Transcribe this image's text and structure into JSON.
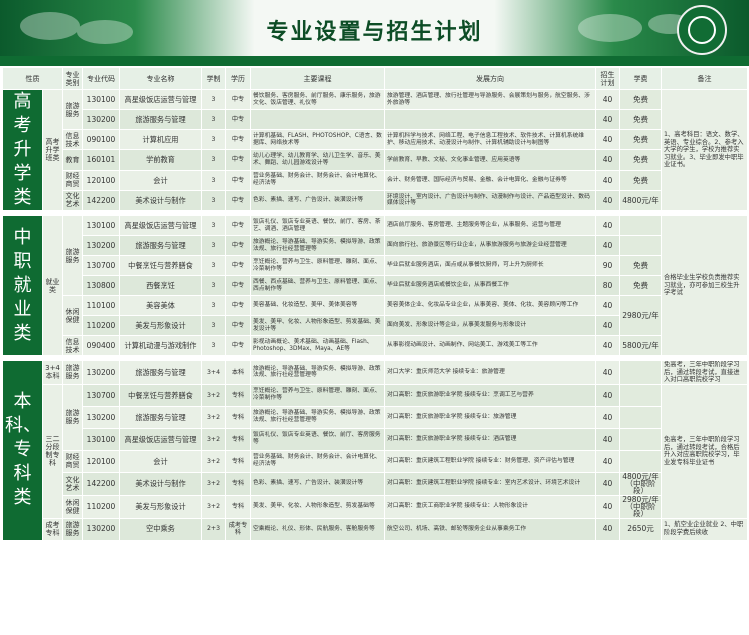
{
  "page": {
    "title": "专业设置与招生计划"
  },
  "headers": [
    "性质",
    "专业类别",
    "专业代码",
    "专业名称",
    "学制",
    "学历",
    "主要课程",
    "发展方向",
    "招生计划",
    "学费",
    "备注"
  ],
  "sections": {
    "gaokao": {
      "band": "高考升学类",
      "category": "高考升学班类",
      "rows": [
        {
          "group": "旅游服务",
          "code": "130100",
          "name": "高星级饭店运营与管理",
          "years": "3",
          "level": "中专",
          "courses": "餐饮服务、客房服务、前厅服务、康乐服务，旅游文化、饭店管理、礼仪等",
          "direction": "旅游管理、酒店管理、旅行社管理与导游服务、会展策划与服务，航空服务、涉外旅游等",
          "plan": "40",
          "fee": "免费"
        },
        {
          "group": "旅游服务",
          "code": "130200",
          "name": "旅游服务与管理",
          "years": "3",
          "level": "中专",
          "courses": "",
          "direction": "",
          "plan": "40",
          "fee": "免费"
        },
        {
          "group": "信息技术",
          "code": "090100",
          "name": "计算机应用",
          "years": "3",
          "level": "中专",
          "courses": "计算机基础、FLASH、PHOTOSHOP、C语言、数据库、网络技术等",
          "direction": "计算机科学与技术、网络工程、电子信息工程技术、软件技术、计算机系统维护、移动应用技术、动漫设计与制作、计算机辅助设计与制图等",
          "plan": "40",
          "fee": "免费"
        },
        {
          "group": "教育",
          "code": "160101",
          "name": "学前教育",
          "years": "3",
          "level": "中专",
          "courses": "幼儿心理学、幼儿教育学、幼儿卫生学、音乐、美术、舞蹈、幼儿园游戏设计等",
          "direction": "学前教育、早教、文秘、文化事业管理、应用英语等",
          "plan": "40",
          "fee": "免费"
        },
        {
          "group": "财经商贸",
          "code": "120100",
          "name": "会计",
          "years": "3",
          "level": "中专",
          "courses": "营业务基础、财务会计、财务会计、会计电算化、经济法等",
          "direction": "会计、财务管理、国际经济与贸易、金融、会计电算化、金融与证券等",
          "plan": "40",
          "fee": "免费"
        },
        {
          "group": "文化艺术",
          "code": "142200",
          "name": "美术设计与制作",
          "years": "3",
          "level": "中专",
          "courses": "色彩、素描、速写、广告设计、装潢设计等",
          "direction": "环境设计、室内设计、广告设计与制作、动漫制作与设计、产品造型设计、数码媒体设计等",
          "plan": "40",
          "fee": "4800元/年"
        }
      ],
      "note": "1、高考科目：语文、数学、英语、专业综合。2、参考入大学的学生，学校为推荐实习就业。3、毕业即发中职毕业证书。"
    },
    "zhongzhi": {
      "band": "中职就业类",
      "category": "就业类",
      "rows": [
        {
          "group": "旅游服务",
          "code": "130100",
          "name": "高星级饭店运营与管理",
          "years": "3",
          "level": "中专",
          "courses": "饭店礼仪、饭店专业英语、餐饮、前厅、客房、茶艺、调酒、酒店管理",
          "direction": "酒店前厅服务、客房管理、主题服务等企业，从事服务、运营与管理",
          "plan": "40",
          "fee": ""
        },
        {
          "group": "旅游服务",
          "code": "130200",
          "name": "旅游服务与管理",
          "years": "3",
          "level": "中专",
          "courses": "旅游概论、导游基础、导游实务、模拟导游、政策法规、旅行社经营管理等",
          "direction": "面向旅行社、旅游景区等行业企业，从事旅游服务与旅游企业经营管理",
          "plan": "40",
          "fee": ""
        },
        {
          "group": "旅游服务",
          "code": "130700",
          "name": "中餐烹饪与营养膳食",
          "years": "3",
          "level": "中专",
          "courses": "烹饪概论、营养与卫生、原料管理、雕刻、面点、冷菜制作等",
          "direction": "毕业后就业服务酒店，面点或从事餐饮厨师，可上升为厨师长",
          "plan": "90",
          "fee": "免费"
        },
        {
          "group": "旅游服务",
          "code": "130800",
          "name": "西餐烹饪",
          "years": "3",
          "level": "中专",
          "courses": "西餐、西点基础、营养与卫生、原料管理、面点、西点制作等",
          "direction": "毕业后就业服务酒店或餐饮企业，从事西餐工作",
          "plan": "80",
          "fee": "免费"
        },
        {
          "group": "休闲保健",
          "code": "110100",
          "name": "美容美体",
          "years": "3",
          "level": "中专",
          "courses": "美容基础、化妆造型、美甲、美体美容等",
          "direction": "美容美体企业、化妆品专业企业，从事美容、美体、化妆、美容顾问等工作",
          "plan": "40",
          "fee": "2980元/年"
        },
        {
          "group": "休闲保健",
          "code": "110200",
          "name": "美发与形象设计",
          "years": "3",
          "level": "中专",
          "courses": "美发、美甲、化妆、人物形象造型、剪发基础、美发设计等",
          "direction": "面向美发、形象设计等企业，从事美发服务与形象设计",
          "plan": "40",
          "fee": ""
        },
        {
          "group": "信息技术",
          "code": "090400",
          "name": "计算机动漫与游戏制作",
          "years": "3",
          "level": "中专",
          "courses": "影视动画概论、美术基础、动画基础、Flash、Photoshop、3DMax、Maya、AE等",
          "direction": "从事影视动画设计、动画制作、网站美工、游戏美工等工作",
          "plan": "40",
          "fee": "5800元/年"
        }
      ],
      "note": "合格毕业生学校负责推荐实习就业，亦可参加三校生升学考试"
    },
    "benke": {
      "band": "本科、专科类",
      "rows": [
        {
          "nature": "3+4本科",
          "group": "旅游服务",
          "code": "130200",
          "name": "旅游服务与管理",
          "years": "3+4",
          "level": "本科",
          "courses": "旅游概论、导游基础、导游实务、模拟导游、政策法规、旅行社经营管理等",
          "direction": "对口大学：重庆师范大学 接续专业：旅游管理",
          "plan": "40",
          "fee": ""
        },
        {
          "nature": "三二分段制专科",
          "group": "旅游服务",
          "code": "130700",
          "name": "中餐烹饪与营养膳食",
          "years": "3+2",
          "level": "专科",
          "courses": "烹饪概论、营养与卫生、原料管理、雕刻、面点、冷菜制作等",
          "direction": "对口高职：重庆旅游职业学院 接续专业：烹调工艺与营养",
          "plan": "40",
          "fee": ""
        },
        {
          "nature": "三二分段制专科",
          "group": "旅游服务",
          "code": "130200",
          "name": "旅游服务与管理",
          "years": "3+2",
          "level": "专科",
          "courses": "旅游概论、导游基础、导游实务、模拟导游、政策法规、旅行社经营管理等",
          "direction": "对口高职：重庆旅游职业学院 接续专业：旅游管理",
          "plan": "40",
          "fee": ""
        },
        {
          "nature": "三二分段制专科",
          "group": "旅游服务",
          "code": "130100",
          "name": "高星级饭店运营与管理",
          "years": "3+2",
          "level": "专科",
          "courses": "饭店礼仪、饭店专业英语、餐饮、前厅、客房服务等",
          "direction": "对口高职：重庆旅游职业学院 接续专业：酒店管理",
          "plan": "40",
          "fee": ""
        },
        {
          "nature": "三二分段制专科",
          "group": "财经商贸",
          "code": "120100",
          "name": "会计",
          "years": "3+2",
          "level": "专科",
          "courses": "营业务基础、财务会计、财务会计、会计电算化、经济法等",
          "direction": "对口高职：重庆建筑工程职业学院 接续专业：财务管理、资产评估与管理",
          "plan": "40",
          "fee": ""
        },
        {
          "nature": "三二分段制专科",
          "group": "文化艺术",
          "code": "142200",
          "name": "美术设计与制作",
          "years": "3+2",
          "level": "专科",
          "courses": "色彩、素描、速写、广告设计、装潢设计等",
          "direction": "对口高职：重庆建筑工程职业学院 接续专业：室内艺术设计、环境艺术设计",
          "plan": "40",
          "fee": "4800元/年（中职阶段）"
        },
        {
          "nature": "三二分段制专科",
          "group": "休闲保健",
          "code": "110200",
          "name": "美发与形象设计",
          "years": "3+2",
          "level": "专科",
          "courses": "美发、美甲、化妆、人物形象造型、剪发基础等",
          "direction": "对口高职：重庆工商职业学院 接续专业：人物形象设计",
          "plan": "40",
          "fee": "2980元/年（中职阶段）"
        },
        {
          "nature": "成考专科",
          "group": "旅游服务",
          "code": "130200",
          "name": "空中乘务",
          "years": "2+3",
          "level": "成考专科",
          "courses": "空乘概论、礼仪、形体、民航服务、客舱服务等",
          "direction": "航空公司、机场、高铁、邮轮等服务企业从事乘务工作",
          "plan": "40",
          "fee": "2650元"
        }
      ],
      "note_top": "免高考，三年中职阶段学习后，通过转段考试，直接进入对口高职院校学习",
      "note_mid": "免高考，三年中职阶段学习后，通过转段考试，合格后升入对应高职院校学习，毕业发专科毕业证书",
      "note_bottom": "1、航空业企业就业 2、中职阶段学费后续收"
    }
  }
}
